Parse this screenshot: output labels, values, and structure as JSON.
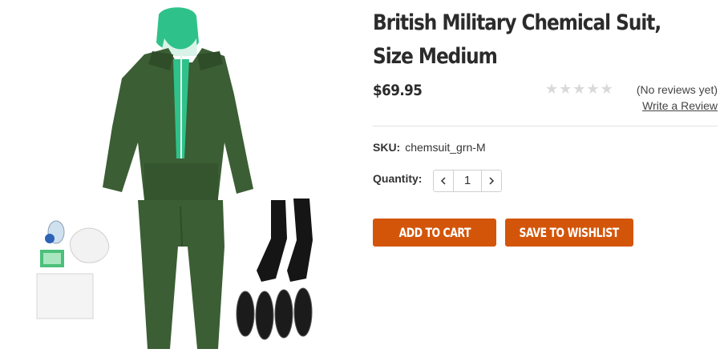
{
  "product": {
    "title": "British Military Chemical Suit, Size Medium",
    "price": "$69.95",
    "rating": {
      "stars_filled": 0,
      "stars_total": 5
    },
    "reviews_text": "(No reviews yet)",
    "write_review_label": "Write a Review",
    "sku_label": "SKU:",
    "sku_value": "chemsuit_grn-M",
    "quantity_label": "Quantity:",
    "quantity_value": "1"
  },
  "buttons": {
    "add_to_cart": "ADD TO CART",
    "save_to_wishlist": "SAVE TO WISHLIST"
  },
  "colors": {
    "accent": "#d3550a",
    "suit_green": "#3b5e34",
    "hood_mint": "#2ec28a",
    "star_empty": "#d9d9d9"
  },
  "icons": [
    "chevron-left-icon",
    "chevron-right-icon",
    "star-icon"
  ]
}
